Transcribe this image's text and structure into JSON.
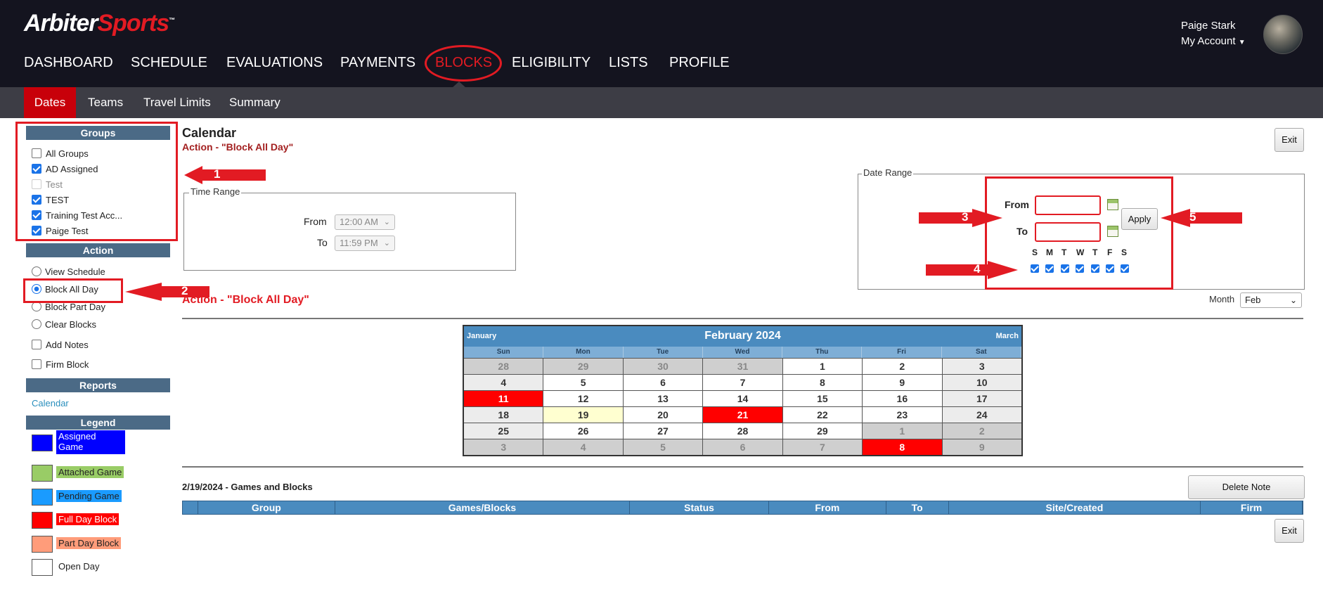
{
  "header": {
    "logo_a": "Arbiter",
    "logo_b": "Sports",
    "nav": [
      "DASHBOARD",
      "SCHEDULE",
      "EVALUATIONS",
      "PAYMENTS",
      "BLOCKS",
      "ELIGIBILITY",
      "LISTS",
      "PROFILE"
    ],
    "active_nav": "BLOCKS",
    "user_name": "Paige Stark",
    "account_label": "My Account"
  },
  "subnav": {
    "items": [
      "Dates",
      "Teams",
      "Travel Limits",
      "Summary"
    ],
    "active": "Dates"
  },
  "sidebar": {
    "groups_title": "Groups",
    "groups": [
      {
        "label": "All Groups",
        "checked": false,
        "disabled": false
      },
      {
        "label": "AD Assigned",
        "checked": true,
        "disabled": false
      },
      {
        "label": "Test",
        "checked": false,
        "disabled": true
      },
      {
        "label": "TEST",
        "checked": true,
        "disabled": false
      },
      {
        "label": "Training Test Acc...",
        "checked": true,
        "disabled": false
      },
      {
        "label": "Paige Test",
        "checked": true,
        "disabled": false
      }
    ],
    "action_title": "Action",
    "actions": [
      "View Schedule",
      "Block All Day",
      "Block Part Day",
      "Clear Blocks"
    ],
    "selected_action": "Block All Day",
    "options": [
      "Add Notes",
      "Firm Block"
    ],
    "reports_title": "Reports",
    "reports_link": "Calendar",
    "legend_title": "Legend",
    "legend": [
      {
        "label": "Assigned Game",
        "color": "#0000ff",
        "text_color": "#ffffff"
      },
      {
        "label": "Attached Game",
        "color": "#99cc66",
        "text_color": "#222222"
      },
      {
        "label": "Pending Game",
        "color": "#1a9bff",
        "text_color": "#222222"
      },
      {
        "label": "Full Day Block",
        "color": "#ff0000",
        "text_color": "#ffffff"
      },
      {
        "label": "Part Day Block",
        "color": "#ff9c7a",
        "text_color": "#222222"
      },
      {
        "label": "Open Day",
        "color": "#ffffff",
        "text_color": "#222222"
      }
    ]
  },
  "annotations": [
    "1",
    "2",
    "3",
    "4",
    "5"
  ],
  "main": {
    "title": "Calendar",
    "action_subtitle": "Action - \"Block All Day\"",
    "exit_label": "Exit",
    "time_range": {
      "legend": "Time Range",
      "from_label": "From",
      "to_label": "To",
      "from_value": "12:00 AM",
      "to_value": "11:59 PM"
    },
    "date_range": {
      "legend": "Date Range",
      "from_label": "From",
      "to_label": "To",
      "apply_label": "Apply",
      "from_value": "",
      "to_value": "",
      "days": [
        "S",
        "M",
        "T",
        "W",
        "T",
        "F",
        "S"
      ],
      "days_checked": [
        true,
        true,
        true,
        true,
        true,
        true,
        true
      ]
    },
    "action_heading": "Action - \"Block All Day\"",
    "month_label": "Month",
    "month_value": "Feb",
    "delete_note_label": "Delete Note",
    "games_blocks_title": "2/19/2024 - Games and Blocks",
    "table_columns": [
      "",
      "Group",
      "Games/Blocks",
      "Status",
      "From",
      "To",
      "Site/Created",
      "Firm"
    ]
  },
  "calendar": {
    "title": "February 2024",
    "prev_label": "January",
    "next_label": "March",
    "dow": [
      "Sun",
      "Mon",
      "Tue",
      "Wed",
      "Thu",
      "Fri",
      "Sat"
    ],
    "weeks": [
      [
        {
          "d": "28",
          "t": "out"
        },
        {
          "d": "29",
          "t": "out"
        },
        {
          "d": "30",
          "t": "out"
        },
        {
          "d": "31",
          "t": "out"
        },
        {
          "d": "1",
          "t": ""
        },
        {
          "d": "2",
          "t": ""
        },
        {
          "d": "3",
          "t": "we"
        }
      ],
      [
        {
          "d": "4",
          "t": "we"
        },
        {
          "d": "5",
          "t": ""
        },
        {
          "d": "6",
          "t": ""
        },
        {
          "d": "7",
          "t": ""
        },
        {
          "d": "8",
          "t": ""
        },
        {
          "d": "9",
          "t": ""
        },
        {
          "d": "10",
          "t": "we"
        }
      ],
      [
        {
          "d": "11",
          "t": "full"
        },
        {
          "d": "12",
          "t": ""
        },
        {
          "d": "13",
          "t": ""
        },
        {
          "d": "14",
          "t": ""
        },
        {
          "d": "15",
          "t": ""
        },
        {
          "d": "16",
          "t": ""
        },
        {
          "d": "17",
          "t": "we"
        }
      ],
      [
        {
          "d": "18",
          "t": "we"
        },
        {
          "d": "19",
          "t": "today"
        },
        {
          "d": "20",
          "t": ""
        },
        {
          "d": "21",
          "t": "full"
        },
        {
          "d": "22",
          "t": ""
        },
        {
          "d": "23",
          "t": ""
        },
        {
          "d": "24",
          "t": "we"
        }
      ],
      [
        {
          "d": "25",
          "t": "we"
        },
        {
          "d": "26",
          "t": ""
        },
        {
          "d": "27",
          "t": ""
        },
        {
          "d": "28",
          "t": ""
        },
        {
          "d": "29",
          "t": ""
        },
        {
          "d": "1",
          "t": "out"
        },
        {
          "d": "2",
          "t": "out"
        }
      ],
      [
        {
          "d": "3",
          "t": "out"
        },
        {
          "d": "4",
          "t": "out"
        },
        {
          "d": "5",
          "t": "out"
        },
        {
          "d": "6",
          "t": "out"
        },
        {
          "d": "7",
          "t": "out"
        },
        {
          "d": "8",
          "t": "full"
        },
        {
          "d": "9",
          "t": "out"
        }
      ]
    ]
  }
}
